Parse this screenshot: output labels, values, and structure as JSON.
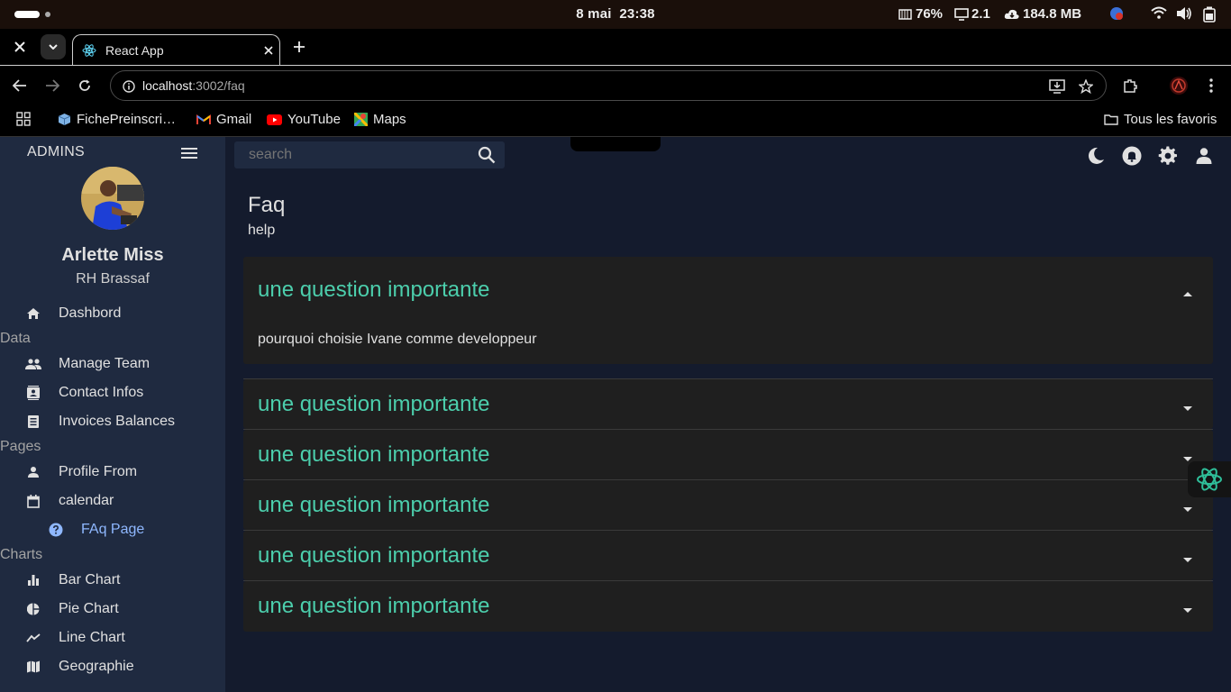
{
  "os": {
    "date": "8 mai",
    "time": "23:38",
    "battery_stat": "76%",
    "display_stat": "2.1",
    "memory_stat": "184.8 MB"
  },
  "browser": {
    "tab_title": "React App",
    "url_host": "localhost",
    "url_path": ":3002/faq",
    "bookmarks": [
      {
        "label": "FichePreinscri…",
        "icon": "cube-icon"
      },
      {
        "label": "Gmail",
        "icon": "gmail-icon"
      },
      {
        "label": "YouTube",
        "icon": "youtube-icon"
      },
      {
        "label": "Maps",
        "icon": "maps-icon"
      }
    ],
    "all_bookmarks_label": "Tous les favoris"
  },
  "sidebar": {
    "brand": "ADMINS",
    "user_name": "Arlette Miss",
    "user_role": "RH Brassaf",
    "dashboard": "Dashbord",
    "section_data": "Data",
    "manage_team": "Manage Team",
    "contact_infos": "Contact Infos",
    "invoices": "Invoices Balances",
    "section_pages": "Pages",
    "profile_form": "Profile From",
    "calendar": "calendar",
    "faq_page": "FAq Page",
    "section_charts": "Charts",
    "bar_chart": "Bar Chart",
    "pie_chart": "Pie Chart",
    "line_chart": "Line Chart",
    "geography": "Geographie"
  },
  "topbar": {
    "search_placeholder": "search"
  },
  "page": {
    "title": "Faq",
    "subtitle": "help"
  },
  "faq": [
    {
      "question": "une question importante",
      "answer": "pourquoi choisie Ivane comme developpeur",
      "expanded": true
    },
    {
      "question": "une question importante",
      "expanded": false
    },
    {
      "question": "une question importante",
      "expanded": false
    },
    {
      "question": "une question importante",
      "expanded": false
    },
    {
      "question": "une question importante",
      "expanded": false
    },
    {
      "question": "une question importante",
      "expanded": false
    }
  ],
  "colors": {
    "app_bg": "#141b2d",
    "sidebar_bg": "#1f2a40",
    "accent_green": "#4cceac",
    "active_blue": "#8fb8ff"
  }
}
